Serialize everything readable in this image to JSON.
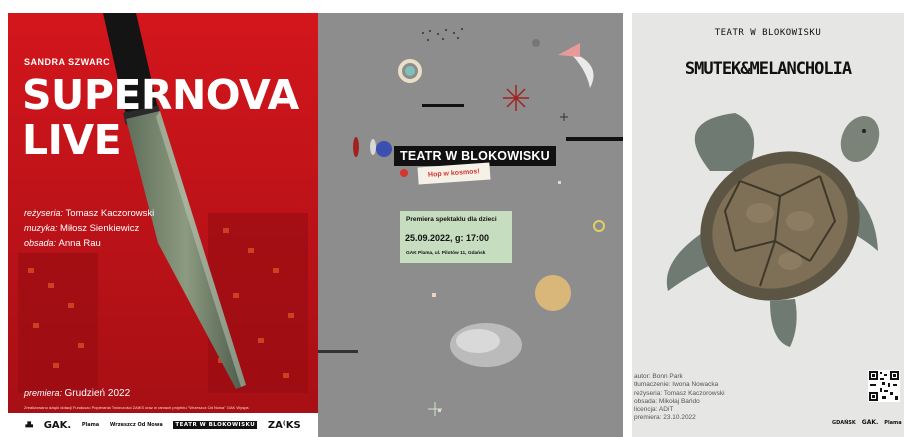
{
  "poster1": {
    "author": "SANDRA SZWARC",
    "title_line1": "SUPERNOVA",
    "title_line2": "LIVE",
    "credits": [
      {
        "label": "reżyseria:",
        "value": "Tomasz Kaczorowski"
      },
      {
        "label": "muzyka:",
        "value": "Miłosz Sienkiewicz"
      },
      {
        "label": "obsada:",
        "value": "Anna Rau"
      }
    ],
    "premiere_label": "premiera:",
    "premiere_value": "Grudzień 2022",
    "funding_note": "Zrealizowano dzięki dotacji Funduszu Popierania Twórczości ZAiKS oraz w ramach projektu \"Wrzeszcz Od Nowa\" GAK Wyspa.",
    "logos": [
      "GAK.",
      "Plama",
      "Wrzeszcz Od Nowa",
      "TEATR W BLOKOWISKU",
      "ZA⁽KS"
    ]
  },
  "poster2": {
    "title": "TEATR W BLOKOWISKU",
    "subtitle": "Hop w kosmos!",
    "box_line1": "Premiera spektaklu dla dzieci",
    "box_line2": "25.09.2022, g: 17:00",
    "box_line3": "GAK Plama, ul. Pilotów 11, Gdańsk"
  },
  "poster3": {
    "org": "TEATR W BLOKOWISKU",
    "title": "SMUTEK&MELANCHOLIA",
    "credits": [
      "autor: Bonn Park",
      "tłumaczenie: Iwona Nowacka",
      "reżyseria: Tomasz Kaczorowski",
      "obsada: Mikołaj Bańdo",
      "licencja: ADiT",
      "premiera: 23.10.2022"
    ],
    "logos": [
      "GDAŃSK",
      "GAK.",
      "Plama"
    ]
  },
  "colors": {
    "poster1_red": "#c4141b",
    "poster2_grey": "#8c8c8c",
    "poster2_box": "#c7ddc0",
    "poster3_bg": "#e6e6e4"
  }
}
